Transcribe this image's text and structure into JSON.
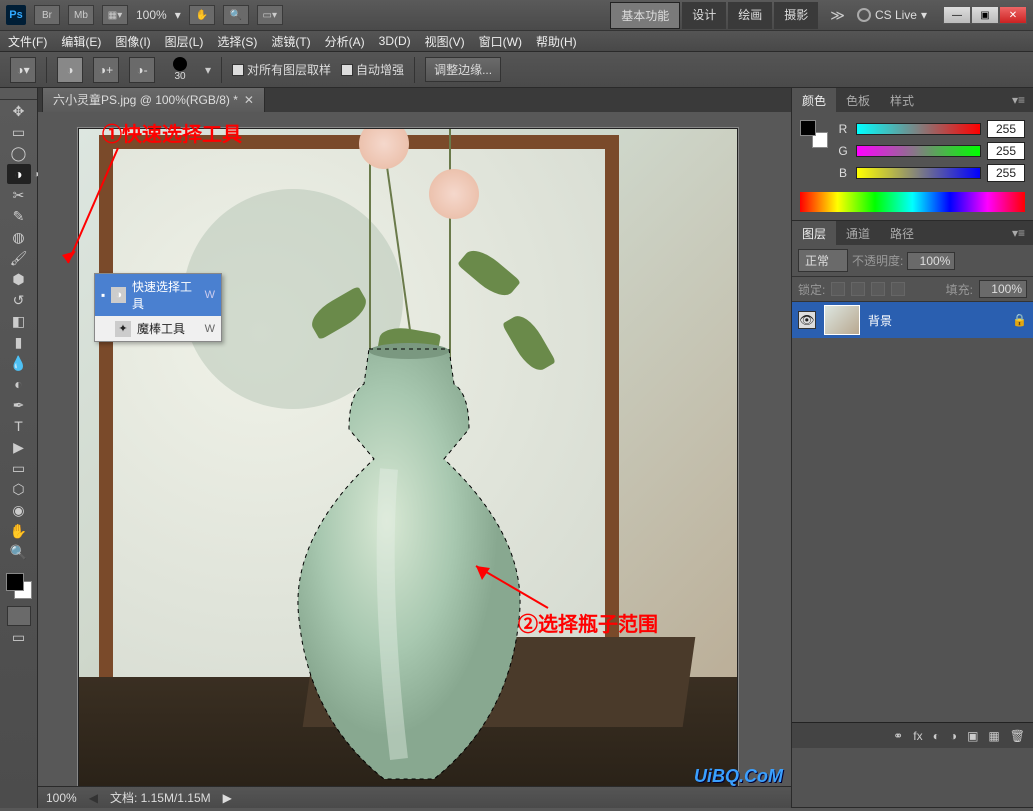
{
  "title": {
    "zoom": "100%"
  },
  "workspace": {
    "tabs": [
      "基本功能",
      "设计",
      "绘画",
      "摄影"
    ],
    "cslive": "CS Live"
  },
  "menubar": [
    "文件(F)",
    "编辑(E)",
    "图像(I)",
    "图层(L)",
    "选择(S)",
    "滤镜(T)",
    "分析(A)",
    "3D(D)",
    "视图(V)",
    "窗口(W)",
    "帮助(H)"
  ],
  "options": {
    "brush_size": "30",
    "sample_all": "对所有图层取样",
    "auto_enhance": "自动增强",
    "refine_edge": "调整边缘..."
  },
  "doc_tab": "六小灵童PS.jpg @ 100%(RGB/8) *",
  "context_menu": {
    "items": [
      {
        "icon": "◑",
        "label": "快速选择工具",
        "key": "W"
      },
      {
        "icon": "✦",
        "label": "魔棒工具",
        "key": "W"
      }
    ]
  },
  "annotations": {
    "a1": "①快速选择工具",
    "a2": "②选择瓶子范围"
  },
  "status": {
    "zoom": "100%",
    "doc": "文档: 1.15M/1.15M"
  },
  "panels": {
    "color": {
      "tabs": [
        "颜色",
        "色板",
        "样式"
      ],
      "r": "255",
      "g": "255",
      "b": "255",
      "r_lbl": "R",
      "g_lbl": "G",
      "b_lbl": "B"
    },
    "layers": {
      "tabs": [
        "图层",
        "通道",
        "路径"
      ],
      "blend": "正常",
      "opacity_lbl": "不透明度:",
      "opacity": "100%",
      "lock_lbl": "锁定:",
      "fill_lbl": "填充:",
      "fill": "100%",
      "layer_name": "背景"
    }
  },
  "watermark": "UiBQ.CoM"
}
